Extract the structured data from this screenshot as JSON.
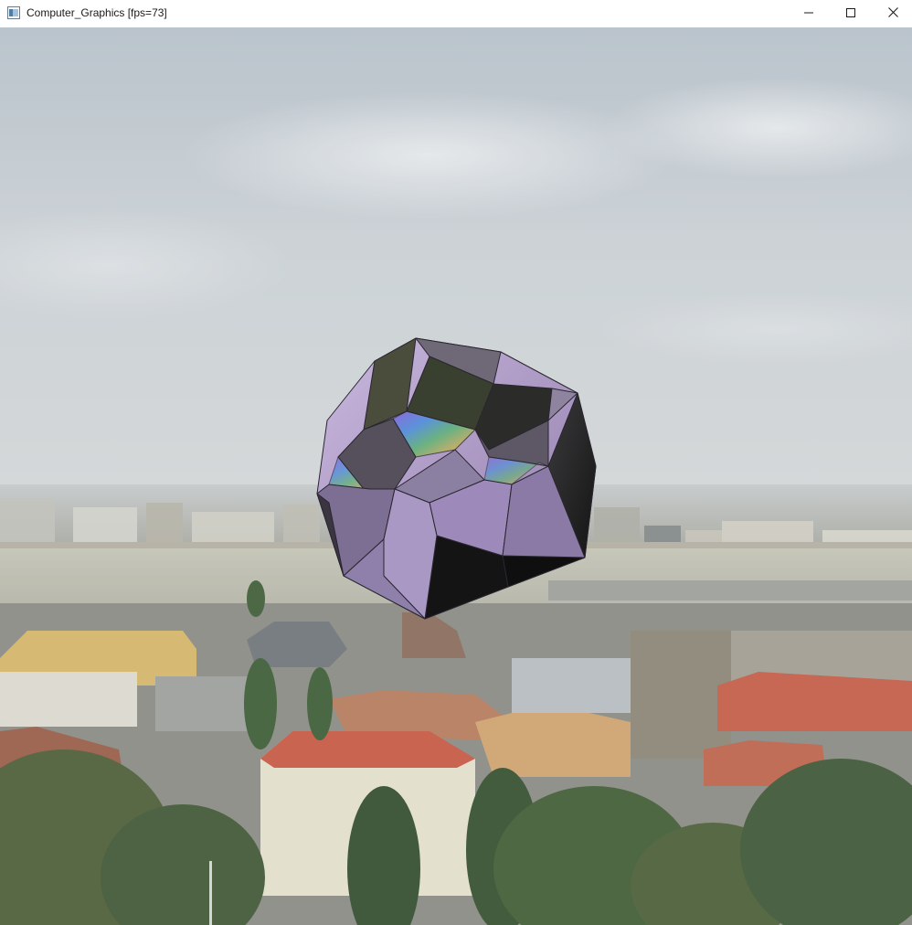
{
  "window": {
    "title": "Computer_Graphics [fps=73]",
    "controls": {
      "minimize_icon": "minimize-icon",
      "maximize_icon": "maximize-icon",
      "close_icon": "close-icon"
    }
  },
  "scene": {
    "background": "city panorama with river and rooftops",
    "object": "reflective polyhedron",
    "colors": {
      "sky": "#cfd6dc",
      "river": "#b9b9a9",
      "roof_tile": "#c2604a",
      "polyhedron": "#a894c2"
    }
  }
}
